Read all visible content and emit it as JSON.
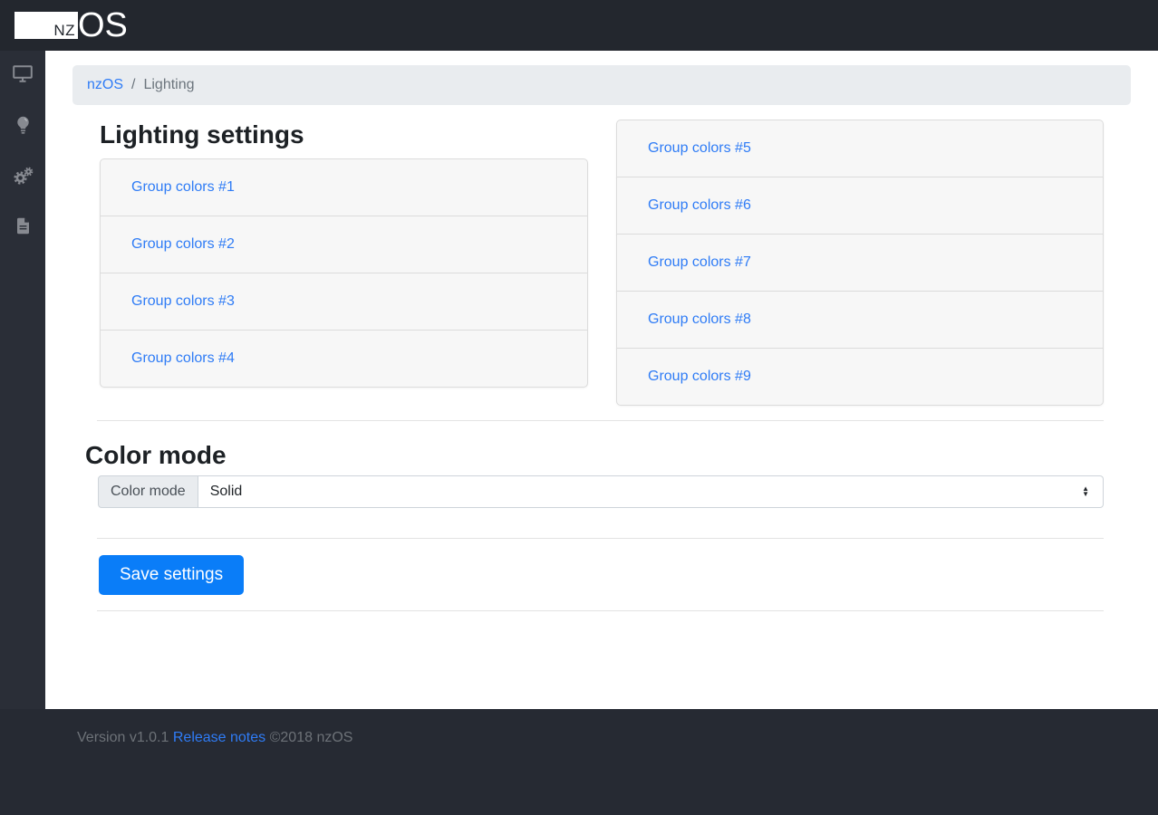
{
  "brand": {
    "box_text": "NZ",
    "suffix": "OS"
  },
  "sidebar": {
    "items": [
      {
        "icon": "desktop-icon"
      },
      {
        "icon": "lightbulb-icon"
      },
      {
        "icon": "gears-icon"
      },
      {
        "icon": "document-icon"
      }
    ]
  },
  "breadcrumb": {
    "home": "nzOS",
    "separator": "/",
    "current": "Lighting"
  },
  "lighting": {
    "title": "Lighting settings",
    "groups_left": [
      "Group colors #1",
      "Group colors #2",
      "Group colors #3",
      "Group colors #4"
    ],
    "groups_right": [
      "Group colors #5",
      "Group colors #6",
      "Group colors #7",
      "Group colors #8",
      "Group colors #9"
    ]
  },
  "color_mode": {
    "title": "Color mode",
    "label": "Color mode",
    "selected": "Solid"
  },
  "actions": {
    "save_label": "Save settings"
  },
  "footer": {
    "version": "Version v1.0.1",
    "release_notes": "Release notes",
    "copyright": "©2018 nzOS"
  },
  "colors": {
    "accent_link": "#2f7cf6",
    "primary_button": "#0a7df8",
    "navbar_bg": "#23272e",
    "sidebar_bg": "#2a2e37",
    "footer_bg": "#262a33",
    "breadcrumb_bg": "#e9ecef",
    "card_header_bg": "#f7f7f7"
  }
}
